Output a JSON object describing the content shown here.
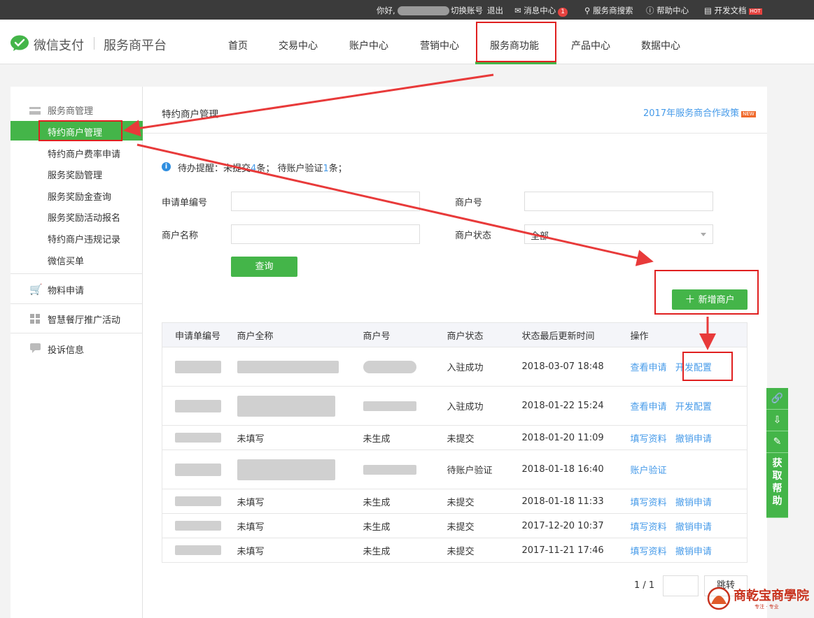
{
  "topbar": {
    "greeting": "你好,",
    "switch_account": "切换账号",
    "logout": "退出",
    "messages": "消息中心",
    "message_count": "1",
    "search": "服务商搜索",
    "help": "帮助中心",
    "docs": "开发文档",
    "docs_badge": "HOT"
  },
  "header": {
    "brand": "微信支付",
    "platform": "服务商平台",
    "nav": [
      "首页",
      "交易中心",
      "账户中心",
      "营销中心",
      "服务商功能",
      "产品中心",
      "数据中心"
    ],
    "active_nav": "服务商功能"
  },
  "sidebar": {
    "groups": [
      {
        "title": "服务商管理",
        "icon": "card-icon",
        "items": [
          "特约商户管理",
          "特约商户费率申请",
          "服务奖励管理",
          "服务奖励金查询",
          "服务奖励活动报名",
          "特约商户违规记录",
          "微信买单"
        ]
      },
      {
        "title": "物料申请",
        "icon": "cart-icon",
        "items": []
      },
      {
        "title": "智慧餐厅推广活动",
        "icon": "grid-icon",
        "items": []
      },
      {
        "title": "投诉信息",
        "icon": "chat-icon",
        "items": []
      }
    ],
    "active_item": "特约商户管理"
  },
  "main": {
    "title": "特约商户管理",
    "policy_link": "2017年服务商合作政策",
    "policy_badge": "NEW",
    "notice": {
      "prefix": "待办提醒：",
      "part1": "未提交",
      "count1": "4",
      "unit1": "条；",
      "part2": "待账户验证",
      "count2": "1",
      "unit2": "条；"
    },
    "form": {
      "app_no_label": "申请单编号",
      "merchant_no_label": "商户号",
      "merchant_name_label": "商户名称",
      "status_label": "商户状态",
      "status_value": "全部",
      "query_button": "查询"
    },
    "add_button": "新增商户",
    "table": {
      "headers": [
        "申请单编号",
        "商户全称",
        "商户号",
        "商户状态",
        "状态最后更新时间",
        "操作"
      ],
      "rows": [
        {
          "name": "",
          "no": "",
          "status": "入驻成功",
          "time": "2018-03-07 18:48",
          "actions": [
            "查看申请",
            "开发配置"
          ]
        },
        {
          "name": "",
          "no": "",
          "status": "入驻成功",
          "time": "2018-01-22 15:24",
          "actions": [
            "查看申请",
            "开发配置"
          ]
        },
        {
          "name": "未填写",
          "no": "未生成",
          "status": "未提交",
          "time": "2018-01-20 11:09",
          "actions": [
            "填写资料",
            "撤销申请"
          ]
        },
        {
          "name": "",
          "no": "",
          "status": "待账户验证",
          "time": "2018-01-18 16:40",
          "actions": [
            "账户验证"
          ]
        },
        {
          "name": "未填写",
          "no": "未生成",
          "status": "未提交",
          "time": "2018-01-18 11:33",
          "actions": [
            "填写资料",
            "撤销申请"
          ]
        },
        {
          "name": "未填写",
          "no": "未生成",
          "status": "未提交",
          "time": "2017-12-20 10:37",
          "actions": [
            "填写资料",
            "撤销申请"
          ]
        },
        {
          "name": "未填写",
          "no": "未生成",
          "status": "未提交",
          "time": "2017-11-21 17:46",
          "actions": [
            "填写资料",
            "撤销申请"
          ]
        }
      ]
    },
    "pagination": {
      "page": "1 / 1",
      "jump": "跳转"
    }
  },
  "helpbar": {
    "label": "获取帮助",
    "icons": [
      "link-icon",
      "download-icon",
      "edit-icon"
    ]
  },
  "watermark": {
    "text": "商乾宝商學院",
    "sub": "专注 · 专业"
  },
  "colors": {
    "accent": "#44b549",
    "link": "#459ae9",
    "highlight": "#e02020",
    "topbar": "#3b3b3b"
  }
}
